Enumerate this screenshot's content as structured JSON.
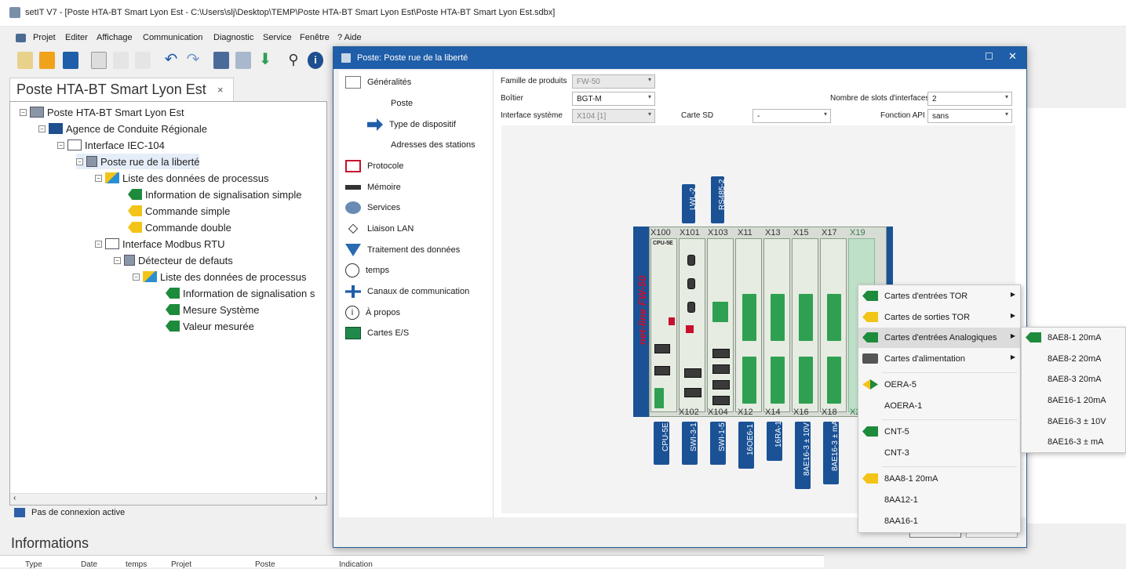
{
  "window": {
    "title": "setIT V7 - [Poste HTA-BT Smart Lyon Est - C:\\Users\\slj\\Desktop\\TEMP\\Poste HTA-BT Smart Lyon Est\\Poste HTA-BT Smart Lyon Est.sdbx]"
  },
  "menu": [
    "Projet",
    "Editer",
    "Affichage",
    "Communication",
    "Diagnostic",
    "Service",
    "Fenêtre",
    "? Aide"
  ],
  "doc_tab": {
    "label": "Poste HTA-BT Smart Lyon Est",
    "close": "×"
  },
  "tree": [
    {
      "label": "Poste HTA-BT Smart Lyon Est"
    },
    {
      "label": "Agence de Conduite Régionale"
    },
    {
      "label": "Interface IEC-104"
    },
    {
      "label": "Poste rue de la liberté"
    },
    {
      "label": "Liste des données de processus"
    },
    {
      "label": "Information de signalisation simple"
    },
    {
      "label": "Commande simple"
    },
    {
      "label": "Commande double"
    },
    {
      "label": "Interface Modbus RTU"
    },
    {
      "label": "Détecteur de defauts"
    },
    {
      "label": "Liste des données de processus"
    },
    {
      "label": "Information de signalisation s"
    },
    {
      "label": "Mesure Système"
    },
    {
      "label": "Valeur mesurée"
    }
  ],
  "status": {
    "connection": "Pas de connexion active"
  },
  "info": {
    "title": "Informations",
    "columns": [
      "Type",
      "Date",
      "temps",
      "Projet",
      "Poste",
      "Indication"
    ]
  },
  "dialog": {
    "title": "Poste: Poste rue de la liberté",
    "nav": [
      "Généralités",
      "Poste",
      "Type de dispositif",
      "Adresses des stations",
      "Protocole",
      "Mémoire",
      "Services",
      "Liaison LAN",
      "Traitement des données",
      "temps",
      "Canaux de communication",
      "À propos",
      "Cartes E/S"
    ],
    "fields": {
      "famille_label": "Famille de produits",
      "famille_value": "FW-50",
      "boitier_label": "Boîtier",
      "boitier_value": "BGT-M",
      "interface_label": "Interface système",
      "interface_value": "X104 [1]",
      "carte_sd_label": "Carte SD",
      "carte_sd_value": "-",
      "slots_label": "Nombre de slots d'interfaces",
      "slots_value": "2",
      "api_label": "Fonction API",
      "api_value": "sans"
    },
    "device": {
      "brand": "net-line FW-50",
      "top_tags": [
        "LWL-2",
        "RS485-2"
      ],
      "top_labels": [
        "X100",
        "X101",
        "X103",
        "X11",
        "X13",
        "X15",
        "X17",
        "X19"
      ],
      "bottom_labels": [
        "X102",
        "X104",
        "X12",
        "X14",
        "X16",
        "X18",
        "X2"
      ],
      "cpu_text": "CPU-5E",
      "bottom_tags": [
        "CPU-5E",
        "SWI-3-1",
        "SWI-1-5",
        "16OE6-1",
        "16RA-1",
        "8AE16-3 ± 10V",
        "8AE16-3 ± mA"
      ]
    }
  },
  "context_menu": {
    "items": [
      "Cartes d'entrées TOR",
      "Cartes de sorties TOR",
      "Cartes d'entrées Analogiques",
      "Cartes d'alimentation",
      "OERA-5",
      "AOERA-1",
      "CNT-5",
      "CNT-3",
      "8AA8-1 20mA",
      "8AA12-1",
      "8AA16-1"
    ]
  },
  "submenu": {
    "items": [
      "8AE8-1 20mA",
      "8AE8-2 20mA",
      "8AE8-3 20mA",
      "8AE16-1 20mA",
      "8AE16-3 ± 10V",
      "8AE16-3 ± mA"
    ]
  }
}
